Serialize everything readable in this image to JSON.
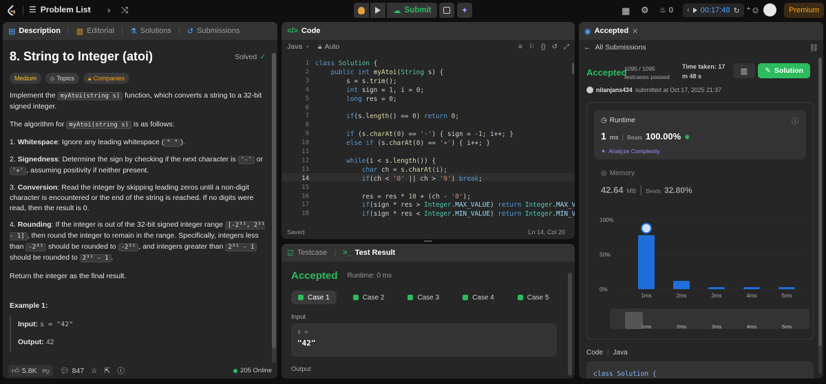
{
  "topbar": {
    "problem_list": "Problem List",
    "submit": "Submit",
    "fire_count": "0",
    "timer": "00:17:48",
    "premium": "Premium"
  },
  "left": {
    "tabs": [
      "Description",
      "Editorial",
      "Solutions",
      "Submissions"
    ],
    "title": "8. String to Integer (atoi)",
    "solved": "Solved",
    "tags": [
      "Medium",
      "Topics",
      "Companies"
    ],
    "intro_a": "Implement the",
    "intro_code": "myAtoi(string s)",
    "intro_b": "function, which converts a string to a 32-bit signed integer.",
    "algo_a": "The algorithm for",
    "algo_code": "myAtoi(string s)",
    "algo_b": "is as follows:",
    "s1_num": "1.",
    "s1_title": "Whitespace",
    "s1_a": ": Ignore any leading whitespace (",
    "s1_code": "\" \"",
    "s1_b": ").",
    "s2_num": "2.",
    "s2_title": "Signedness",
    "s2_a": ": Determine the sign by checking if the next character is",
    "s2_code1": "'-'",
    "s2_or": "or",
    "s2_code2": "'+'",
    "s2_b": ", assuming positivity if neither present.",
    "s3_num": "3.",
    "s3_title": "Conversion",
    "s3_a": ": Read the integer by skipping leading zeros until a non-digit character is encountered or the end of the string is reached. If no digits were read, then the result is 0.",
    "s4_num": "4.",
    "s4_title": "Rounding",
    "s4_a": ": If the integer is out of the 32-bit signed integer range",
    "s4_code1": "[-2³¹, 2³¹ - 1]",
    "s4_b": ", then round the integer to remain in the range. Specifically, integers less than",
    "s4_code2": "-2³¹",
    "s4_c": "should be rounded to",
    "s4_code3": "-2³¹",
    "s4_d": ", and integers greater than",
    "s4_code4": "2³¹ - 1",
    "s4_e": "should be rounded to",
    "s4_code5": "2³¹ - 1",
    "s4_f": ".",
    "ret": "Return the integer as the final result.",
    "example": "Example 1:",
    "input_label": "Input:",
    "input_val": "s = \"42\"",
    "output_label": "Output:",
    "output_val": "42",
    "likes": "5.8K",
    "comments": "847",
    "online": "205 Online"
  },
  "code": {
    "header": "Code",
    "lang": "Java",
    "mode": "Auto",
    "status": "Saved",
    "cursor": "Ln 14, Col 20",
    "lines": [
      "class Solution {",
      "    public int myAtoi(String s) {",
      "        s = s.trim();",
      "        int sign = 1, i = 0;",
      "        long res = 0;",
      "",
      "        if(s.length() == 0) return 0;",
      "",
      "        if (s.charAt(0) == '-') { sign = -1; i++; }",
      "        else if (s.charAt(0) == '+') { i++; }",
      "",
      "        while(i < s.length()) {",
      "            char ch = s.charAt(i);",
      "            if(ch < '0' || ch > '9') break;",
      "",
      "            res = res * 10 + (ch - '0');",
      "            if(sign * res > Integer.MAX_VALUE) return Integer.MAX_VALUE;",
      "            if(sign * res < Integer.MIN_VALUE) return Integer.MIN_VALUE;"
    ]
  },
  "test": {
    "tab_testcase": "Testcase",
    "tab_result": "Test Result",
    "status": "Accepted",
    "runtime": "Runtime: 0 ms",
    "cases": [
      "Case 1",
      "Case 2",
      "Case 3",
      "Case 4",
      "Case 5"
    ],
    "input_label": "Input",
    "var": "s =",
    "val": "\"42\"",
    "output_label": "Output"
  },
  "result": {
    "tab": "Accepted",
    "back": "All Submissions",
    "status": "Accepted",
    "passed": "1095 / 1095",
    "passed_label": "testcases passed",
    "time_taken_a": "Time taken: 17",
    "time_taken_b": "m 48 s",
    "solution": "Solution",
    "user": "nilanjans434",
    "submitted": "submitted at Oct 17, 2025 21:37",
    "runtime_label": "Runtime",
    "runtime_val": "1",
    "runtime_unit": "ms",
    "beats_label": "Beats",
    "runtime_beats": "100.00%",
    "analyze": "Analyze Complexity",
    "memory_label": "Memory",
    "memory_val": "42.64",
    "memory_unit": "MB",
    "memory_beats": "32.80%",
    "code_label": "Code",
    "code_lang": "Java",
    "code_preview": "class Solution {"
  },
  "chart_data": {
    "type": "bar",
    "categories": [
      "1ms",
      "2ms",
      "3ms",
      "4ms",
      "5ms"
    ],
    "values": [
      78,
      12,
      2,
      2,
      2
    ],
    "ylim": [
      0,
      100
    ],
    "yticks": [
      "100%",
      "50%",
      "0%"
    ],
    "accent": "#1e6fd9"
  },
  "colors": {
    "accent_green": "#2cbb5d",
    "premium": "#ffa116",
    "medium": "#ffc01e"
  }
}
